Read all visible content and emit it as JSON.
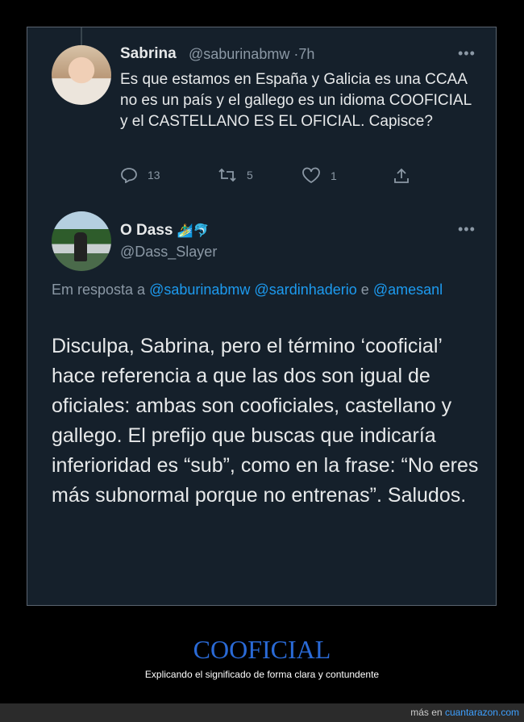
{
  "tweet1": {
    "name": "Sabrina",
    "handle": "@saburinabmw",
    "sep": "·",
    "time": "7h",
    "more": "•••",
    "text": "Es que estamos en España y Galicia es una CCAA no es un país y el gallego es un idioma COOFICIAL y el CASTELLANO ES EL OFICIAL. Capisce?",
    "replies": "13",
    "retweets": "5",
    "likes": "1"
  },
  "tweet2": {
    "name": "O Dass",
    "emoji": "🏄‍♂️🐬",
    "handle": "@Dass_Slayer",
    "more": "•••",
    "reply_prefix": "Em resposta a",
    "reply_mention1": "@saburinabmw",
    "reply_mention2": "@sardinhaderio",
    "reply_and": "e",
    "reply_mention3": "@amesanl",
    "text": "Disculpa, Sabrina, pero el término ‘cooficial’ hace referencia a que las dos son igual de oficiales: ambas son cooficiales, castellano y gallego. El prefijo que buscas que indicaría inferioridad es “sub”, como en la frase: “No eres más subnormal porque no entrenas”. Saludos."
  },
  "caption": {
    "title": "COOFICIAL",
    "subtitle": "Explicando el significado de forma clara y contundente"
  },
  "footer": {
    "prefix": "más en",
    "site": "cuantarazon.com"
  },
  "colors": {
    "background": "#15202b",
    "link": "#1d9bf0",
    "muted": "#8b98a5",
    "caption_title": "#2a6ad6"
  }
}
